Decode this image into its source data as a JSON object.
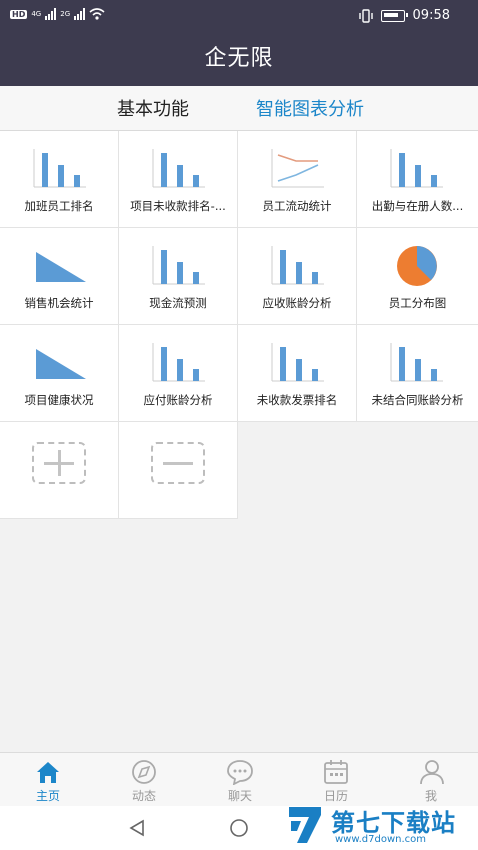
{
  "status_bar": {
    "hd_label": "HD",
    "net_label_1": "4G",
    "net_label_2": "2G",
    "time": "09:58"
  },
  "header": {
    "title": "企无限"
  },
  "tabs": [
    {
      "label": "基本功能",
      "active": false
    },
    {
      "label": "智能图表分析",
      "active": true
    }
  ],
  "grid": {
    "items": [
      {
        "label": "加班员工排名",
        "icon": "bar-chart-icon"
      },
      {
        "label": "项目未收款排名-...",
        "icon": "bar-chart-icon"
      },
      {
        "label": "员工流动统计",
        "icon": "line-chart-icon"
      },
      {
        "label": "出勤与在册人数...",
        "icon": "bar-chart-icon"
      },
      {
        "label": "销售机会统计",
        "icon": "area-chart-icon"
      },
      {
        "label": "现金流预测",
        "icon": "bar-chart-icon"
      },
      {
        "label": "应收账龄分析",
        "icon": "bar-chart-icon"
      },
      {
        "label": "员工分布图",
        "icon": "pie-chart-icon"
      },
      {
        "label": "项目健康状况",
        "icon": "area-chart-icon"
      },
      {
        "label": "应付账龄分析",
        "icon": "bar-chart-icon"
      },
      {
        "label": "未收款发票排名",
        "icon": "bar-chart-icon"
      },
      {
        "label": "未结合同账龄分析",
        "icon": "bar-chart-icon"
      }
    ],
    "add_icon": "add-icon",
    "remove_icon": "remove-icon"
  },
  "bottom_nav": [
    {
      "label": "主页",
      "icon": "home-icon",
      "active": true
    },
    {
      "label": "动态",
      "icon": "compass-icon",
      "active": false
    },
    {
      "label": "聊天",
      "icon": "chat-icon",
      "active": false
    },
    {
      "label": "日历",
      "icon": "calendar-icon",
      "active": false
    },
    {
      "label": "我",
      "icon": "user-icon",
      "active": false
    }
  ],
  "watermark": {
    "text": "第七下载站",
    "url": "www.d7down.com"
  },
  "colors": {
    "header_bg": "#3d3b4f",
    "accent": "#1c86c9",
    "chart_blue": "#5b9bd5",
    "chart_orange": "#ed7d31"
  }
}
